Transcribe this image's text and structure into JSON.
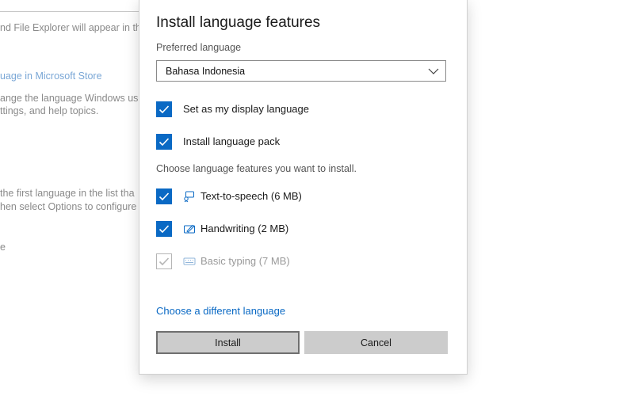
{
  "background": {
    "lines": [
      "nd File Explorer will appear in th",
      "uage in Microsoft Store",
      "ange the language Windows us",
      "ttings, and help topics.",
      "the first language in the list tha",
      "hen select Options to configure",
      "e"
    ]
  },
  "dialog": {
    "title": "Install language features",
    "preferred_label": "Preferred language",
    "selected_language": "Bahasa Indonesia",
    "options": [
      {
        "label": "Set as my display language",
        "checked": true
      },
      {
        "label": "Install language pack",
        "checked": true
      }
    ],
    "features_heading": "Choose language features you want to install.",
    "features": [
      {
        "label": "Text-to-speech (6 MB)",
        "icon": "text-to-speech-icon",
        "checked": true,
        "disabled": false
      },
      {
        "label": "Handwriting (2 MB)",
        "icon": "handwriting-icon",
        "checked": true,
        "disabled": false
      },
      {
        "label": "Basic typing (7 MB)",
        "icon": "keyboard-icon",
        "checked": true,
        "disabled": true
      }
    ],
    "link": "Choose a different language",
    "install_label": "Install",
    "cancel_label": "Cancel"
  },
  "colors": {
    "accent": "#0a69c4",
    "button": "#cccccc",
    "link": "#0a69c4"
  }
}
